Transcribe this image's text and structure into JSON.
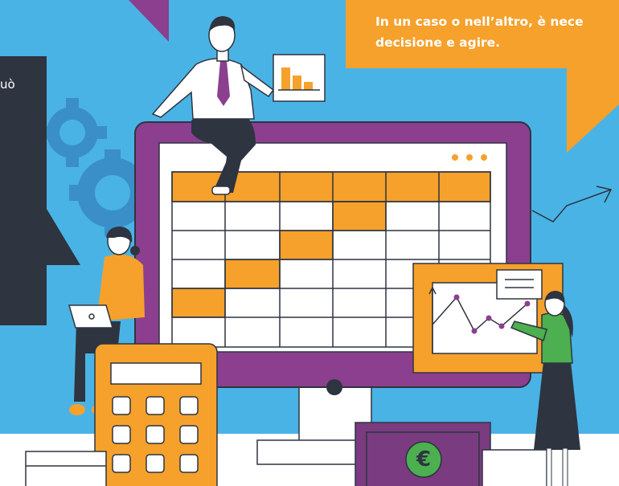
{
  "colors": {
    "sky": "#4ab3e6",
    "monitor": "#8b3f8e",
    "orange": "#f5a12b",
    "dark": "#2e3440",
    "gear": "#3a8fc9",
    "money": "#7a3b80",
    "euro_badge": "#4caf50"
  },
  "speech_bubble": {
    "line1": "In un caso o nell’altro, è nece",
    "line2": "decisione e agire."
  },
  "dark_box": {
    "fragment": "uò"
  },
  "money": {
    "symbol": "€"
  },
  "icons": [
    "gear-icon",
    "trend-arrow-icon",
    "bar-chart-icon",
    "line-chart-icon",
    "laptop-icon",
    "calculator-icon",
    "banknote-icon",
    "euro-icon"
  ]
}
